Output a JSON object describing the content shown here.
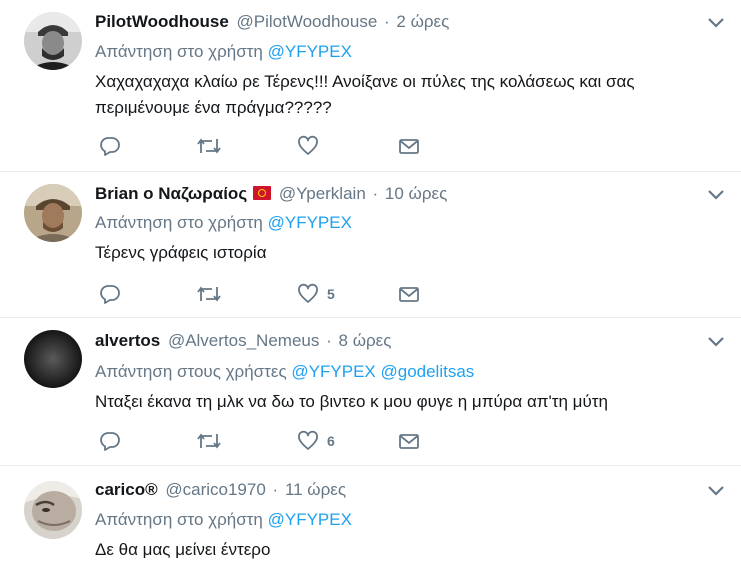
{
  "tweets": [
    {
      "name": "PilotWoodhouse",
      "handle": "@PilotWoodhouse",
      "time": "2 ώρες",
      "reply_prefix": "Απάντηση στο χρήστη",
      "mentions": [
        "@YFYPEX"
      ],
      "text": "Χαχαχαχαχα κλαίω ρε Τέρενς!!! Ανοίξανε οι πύλες της κολάσεως και σας περιμένουμε ένα πράγμα?????",
      "like_count": ""
    },
    {
      "name": "Brian o Ναζωραίος",
      "handle": "@Yperklain",
      "time": "10 ώρες",
      "reply_prefix": "Απάντηση στο χρήστη",
      "mentions": [
        "@YFYPEX"
      ],
      "text": "Τέρενς γράφεις ιστορία",
      "like_count": "5"
    },
    {
      "name": "alvertos",
      "handle": "@Alvertos_Nemeus",
      "time": "8 ώρες",
      "reply_prefix": "Απάντηση στους χρήστες",
      "mentions": [
        "@YFYPEX",
        "@godelitsas"
      ],
      "text": "Νταξει έκανα τη μλκ να δω το βιντεο κ μου φυγε η μπύρα απ'τη μύτη",
      "like_count": "6"
    },
    {
      "name": "carico®",
      "handle": "@carico1970",
      "time": "11 ώρες",
      "reply_prefix": "Απάντηση στο χρήστη",
      "mentions": [
        "@YFYPEX"
      ],
      "text": "Δε θα μας μείνει έντερο",
      "like_count": ""
    }
  ],
  "separator": "·",
  "colors": {
    "accent": "#1da1f2",
    "muted": "#657786",
    "text": "#14171a",
    "border": "#e6ecf0"
  },
  "icons": [
    "reply-icon",
    "retweet-icon",
    "like-icon",
    "direct-message-icon",
    "chevron-down-icon",
    "isle-of-man-flag-icon"
  ]
}
